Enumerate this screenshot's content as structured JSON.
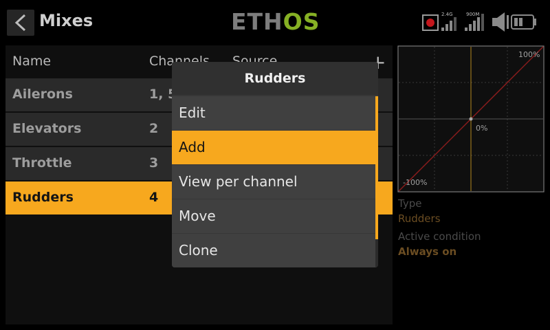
{
  "header": {
    "title": "Mixes",
    "logo_prefix": "ETH",
    "logo_suffix": "OS",
    "rx_label_1": "2.4G",
    "rx_label_2": "900M"
  },
  "list": {
    "columns": [
      "Name",
      "Channels",
      "Source"
    ],
    "add_icon": "plus-icon",
    "rows": [
      {
        "name": "Ailerons",
        "channels": "1, 5"
      },
      {
        "name": "Elevators",
        "channels": "2"
      },
      {
        "name": "Throttle",
        "channels": "3"
      },
      {
        "name": "Rudders",
        "channels": "4",
        "selected": true
      }
    ]
  },
  "curve": {
    "label_max": "100%",
    "label_mid": "0%",
    "label_min": "-100%"
  },
  "details": {
    "type_label": "Type",
    "type_value": "Rudders",
    "condition_label": "Active condition",
    "condition_value": "Always on"
  },
  "popup": {
    "title": "Rudders",
    "items": [
      {
        "label": "Edit"
      },
      {
        "label": "Add",
        "active": true
      },
      {
        "label": "View per channel"
      },
      {
        "label": "Move"
      },
      {
        "label": "Clone"
      }
    ]
  },
  "colors": {
    "accent": "#f7a81e",
    "logo_green": "#86b024",
    "curve_line": "#8a1c1c",
    "background": "#000000"
  }
}
